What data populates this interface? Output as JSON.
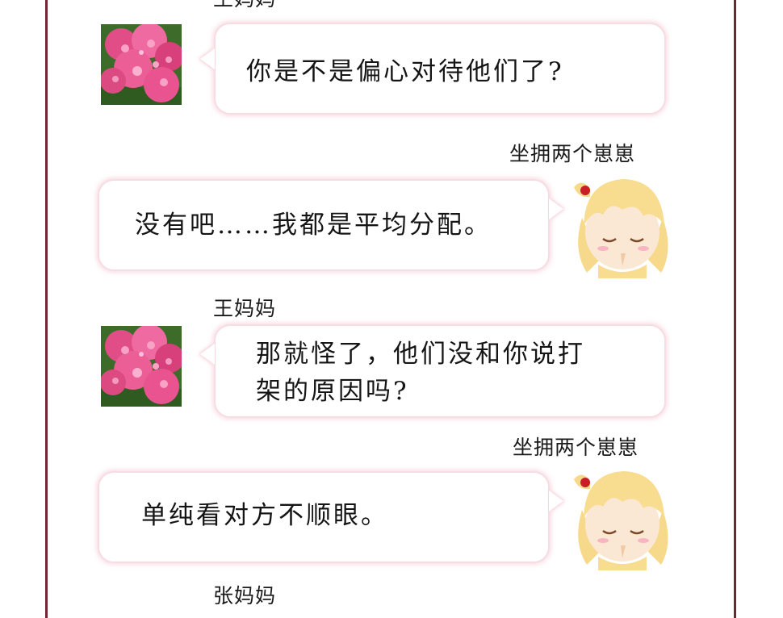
{
  "messages": [
    {
      "sender": "王妈妈",
      "text": "你是不是偏心对待他们了?",
      "avatar": "hydrangea-avatar"
    },
    {
      "sender": "坐拥两个崽崽",
      "text": "没有吧……我都是平均分配。",
      "avatar": "chibi-girl-avatar"
    },
    {
      "sender": "王妈妈",
      "text_line1": "那就怪了，他们没和你说打",
      "text_line2": "架的原因吗?",
      "avatar": "hydrangea-avatar"
    },
    {
      "sender": "坐拥两个崽崽",
      "text": "单纯看对方不顺眼。",
      "avatar": "chibi-girl-avatar"
    },
    {
      "sender": "张妈妈"
    }
  ],
  "colors": {
    "frame_border": "#6e2632",
    "bubble_border": "#f6dde3",
    "hydrangea_pink": "#e5508c",
    "hair_blonde": "#f7dc8e",
    "hair_bow": "#c81f26"
  }
}
